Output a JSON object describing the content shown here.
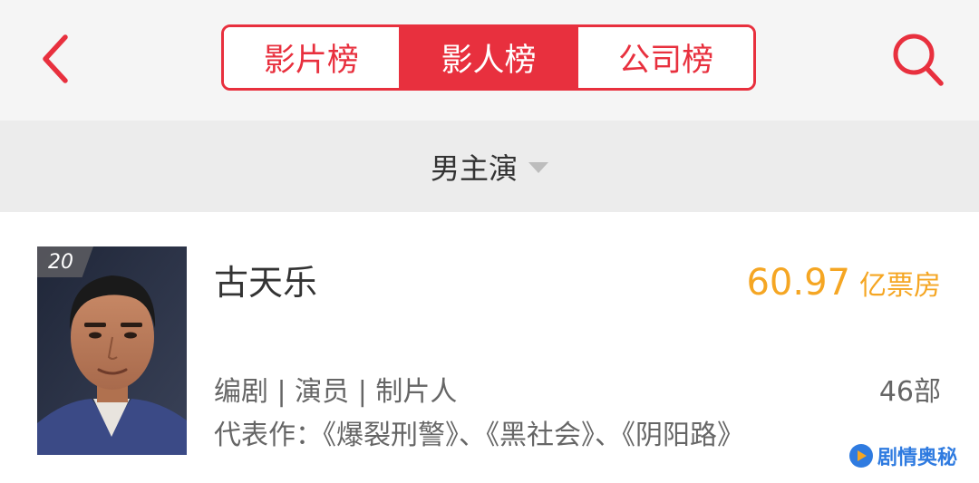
{
  "header": {
    "back_icon": "chevron-left-icon",
    "tabs": [
      {
        "label": "影片榜",
        "active": false
      },
      {
        "label": "影人榜",
        "active": true
      },
      {
        "label": "公司榜",
        "active": false
      }
    ],
    "search_icon": "search-icon"
  },
  "filter": {
    "label": "男主演",
    "caret_icon": "caret-down-icon"
  },
  "card": {
    "rank": "20",
    "name": "古天乐",
    "boxoffice_value": "60.97",
    "boxoffice_unit": "亿票房",
    "roles": "编剧 | 演员 | 制片人",
    "works_count": "46部",
    "representative": "代表作：《爆裂刑警》、《黑社会》、《阴阳路》"
  },
  "watermark": {
    "text": "剧情奥秘"
  },
  "colors": {
    "accent": "#e8303e",
    "boxoffice": "#f5a623",
    "header_bg": "#f5f5f5",
    "filter_bg": "#ececec",
    "text_primary": "#333333",
    "text_secondary": "#666666",
    "watermark": "#2f7be0"
  }
}
